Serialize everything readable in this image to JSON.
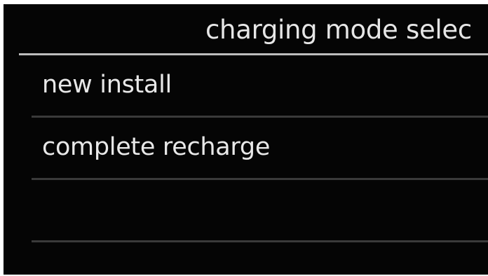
{
  "header": {
    "title": "charging mode selec"
  },
  "menu": {
    "items": [
      {
        "label": "new install"
      },
      {
        "label": "complete recharge"
      },
      {
        "label": ""
      }
    ]
  }
}
